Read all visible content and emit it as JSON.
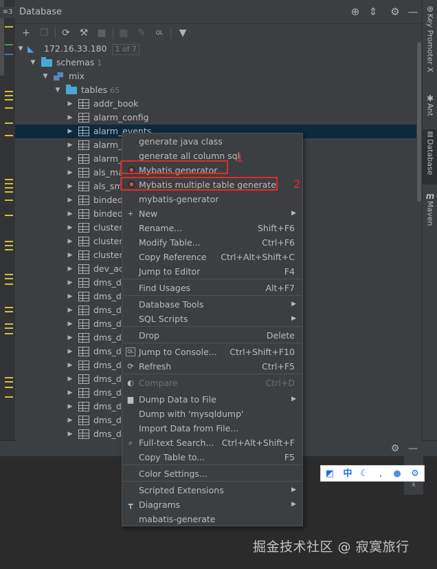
{
  "window": {
    "title": "Database",
    "menu_glyph": "≡3"
  },
  "header_icons": [
    "crosshair-icon",
    "collapse-icon",
    "gear-icon",
    "minimize-icon"
  ],
  "toolbar": {
    "tools": [
      "add-icon",
      "copy-icon",
      "refresh-icon",
      "properties-icon",
      "stop-icon",
      "grid-icon",
      "edit-icon",
      "sql-console-icon",
      "filter-icon"
    ]
  },
  "tree": {
    "host": {
      "label": "172.16.33.180",
      "badge": "1 of 7"
    },
    "schemas": {
      "label": "schemas",
      "count": "1"
    },
    "schema": {
      "label": "mix"
    },
    "tables_folder": {
      "label": "tables",
      "count": "65"
    },
    "tables": [
      "addr_book",
      "alarm_config",
      "alarm_events",
      "alarm_r",
      "alarm_r",
      "als_ma",
      "als_sms",
      "binded",
      "binded",
      "cluster",
      "cluster_",
      "cluster_",
      "dev_acc",
      "dms_de",
      "dms_de",
      "dms_de",
      "dms_de",
      "dms_de",
      "dms_de",
      "dms_de",
      "dms_de",
      "dms_de",
      "dms_de",
      "dms_de",
      "dms_de"
    ],
    "selected_index": 2
  },
  "right_tabs": [
    {
      "label": "Key Promoter X",
      "icon": "key-promoter-icon"
    },
    {
      "label": "Ant",
      "icon": "ant-icon"
    },
    {
      "label": "Database",
      "icon": "database-icon"
    },
    {
      "label": "Maven",
      "icon": "maven-icon"
    }
  ],
  "context_menu": {
    "items": [
      {
        "label": "generate java class",
        "shortcut": "",
        "icon": ""
      },
      {
        "label": "generate all column sql",
        "shortcut": "",
        "icon": ""
      },
      {
        "label": "Mybatis generator",
        "shortcut": "",
        "icon": "mybatis-bird-icon"
      },
      {
        "label": "Mybatis multiple table generate",
        "shortcut": "",
        "icon": "mybatis-bird-icon"
      },
      {
        "label": "mybatis-generator",
        "shortcut": "",
        "icon": ""
      },
      {
        "label": "New",
        "shortcut": "",
        "icon": "plus-icon",
        "submenu": true
      },
      {
        "label": "Rename...",
        "shortcut": "Shift+F6",
        "icon": ""
      },
      {
        "label": "Modify Table...",
        "shortcut": "Ctrl+F6",
        "icon": ""
      },
      {
        "label": "Copy Reference",
        "shortcut": "Ctrl+Alt+Shift+C",
        "icon": ""
      },
      {
        "label": "Jump to Editor",
        "shortcut": "F4",
        "icon": ""
      },
      {
        "label": "Find Usages",
        "shortcut": "Alt+F7",
        "icon": ""
      },
      {
        "label": "Database Tools",
        "shortcut": "",
        "icon": "",
        "submenu": true
      },
      {
        "label": "SQL Scripts",
        "shortcut": "",
        "icon": "",
        "submenu": true
      },
      {
        "label": "Drop",
        "shortcut": "Delete",
        "icon": ""
      },
      {
        "label": "Jump to Console...",
        "shortcut": "Ctrl+Shift+F10",
        "icon": "console-icon"
      },
      {
        "label": "Refresh",
        "shortcut": "Ctrl+F5",
        "icon": "refresh-icon"
      },
      {
        "label": "Compare",
        "shortcut": "Ctrl+D",
        "icon": "compare-icon",
        "disabled": true
      },
      {
        "label": "Dump Data to File",
        "shortcut": "",
        "icon": "save-icon",
        "submenu": true
      },
      {
        "label": "Dump with 'mysqldump'",
        "shortcut": "",
        "icon": ""
      },
      {
        "label": "Import Data from File...",
        "shortcut": "",
        "icon": ""
      },
      {
        "label": "Full-text Search...",
        "shortcut": "Ctrl+Alt+Shift+F",
        "icon": "search-icon"
      },
      {
        "label": "Copy Table to...",
        "shortcut": "F5",
        "icon": ""
      },
      {
        "label": "Color Settings...",
        "shortcut": "",
        "icon": ""
      },
      {
        "label": "Scripted Extensions",
        "shortcut": "",
        "icon": "",
        "submenu": true
      },
      {
        "label": "Diagrams",
        "shortcut": "",
        "icon": "diagram-icon",
        "submenu": true
      },
      {
        "label": "mabatis-generate",
        "shortcut": "",
        "icon": ""
      }
    ]
  },
  "annotations": {
    "first": "1",
    "second": "2"
  },
  "ime_bar": {
    "chinese_mode": "中"
  },
  "watermark": "掘金技术社区 @ 寂寞旅行",
  "colors": {
    "highlight": "#e32a2a",
    "selection": "#0d293e",
    "background": "#3c3f41"
  }
}
